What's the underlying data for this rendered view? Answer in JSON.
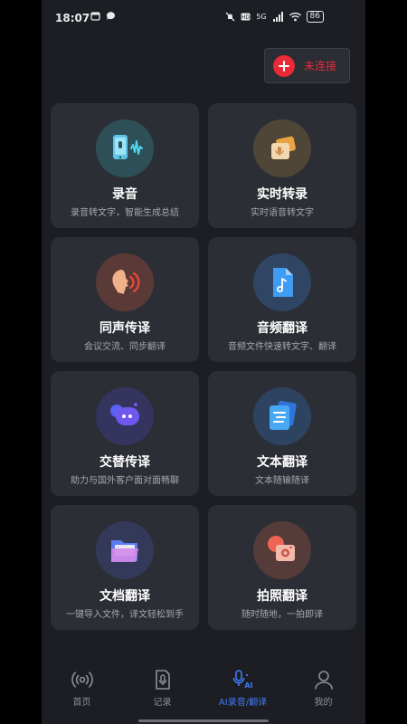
{
  "status_bar": {
    "time": "18:07",
    "signal_label": "5G",
    "battery": "86"
  },
  "connect_button": {
    "label": "未连接",
    "color": "#ea2a36"
  },
  "cards": [
    {
      "title": "录音",
      "subtitle": "录音转文字，智能生成总结",
      "icon": "recording-icon"
    },
    {
      "title": "实时转录",
      "subtitle": "实时语音转文字",
      "icon": "realtime-transcribe-icon"
    },
    {
      "title": "同声传译",
      "subtitle": "会议交流、同步翻译",
      "icon": "simultaneous-interpret-icon"
    },
    {
      "title": "音频翻译",
      "subtitle": "音频文件快速转文字、翻译",
      "icon": "audio-file-icon"
    },
    {
      "title": "交替传译",
      "subtitle": "助力与国外客户面对面畅聊",
      "icon": "chat-bot-icon"
    },
    {
      "title": "文本翻译",
      "subtitle": "文本随输随译",
      "icon": "text-translate-icon"
    },
    {
      "title": "文档翻译",
      "subtitle": "一键导入文件，译文轻松到手",
      "icon": "folder-icon"
    },
    {
      "title": "拍照翻译",
      "subtitle": "随时随地，一拍即译",
      "icon": "camera-icon"
    }
  ],
  "tabs": [
    {
      "label": "首页",
      "icon": "broadcast-icon"
    },
    {
      "label": "记录",
      "icon": "record-doc-icon"
    },
    {
      "label": "AI录音/翻译",
      "icon": "ai-mic-icon",
      "active": true
    },
    {
      "label": "我的",
      "icon": "profile-icon"
    }
  ],
  "colors": {
    "accent": "#3f7bf5",
    "background": "#1c1e23",
    "card": "#2b2e34"
  }
}
